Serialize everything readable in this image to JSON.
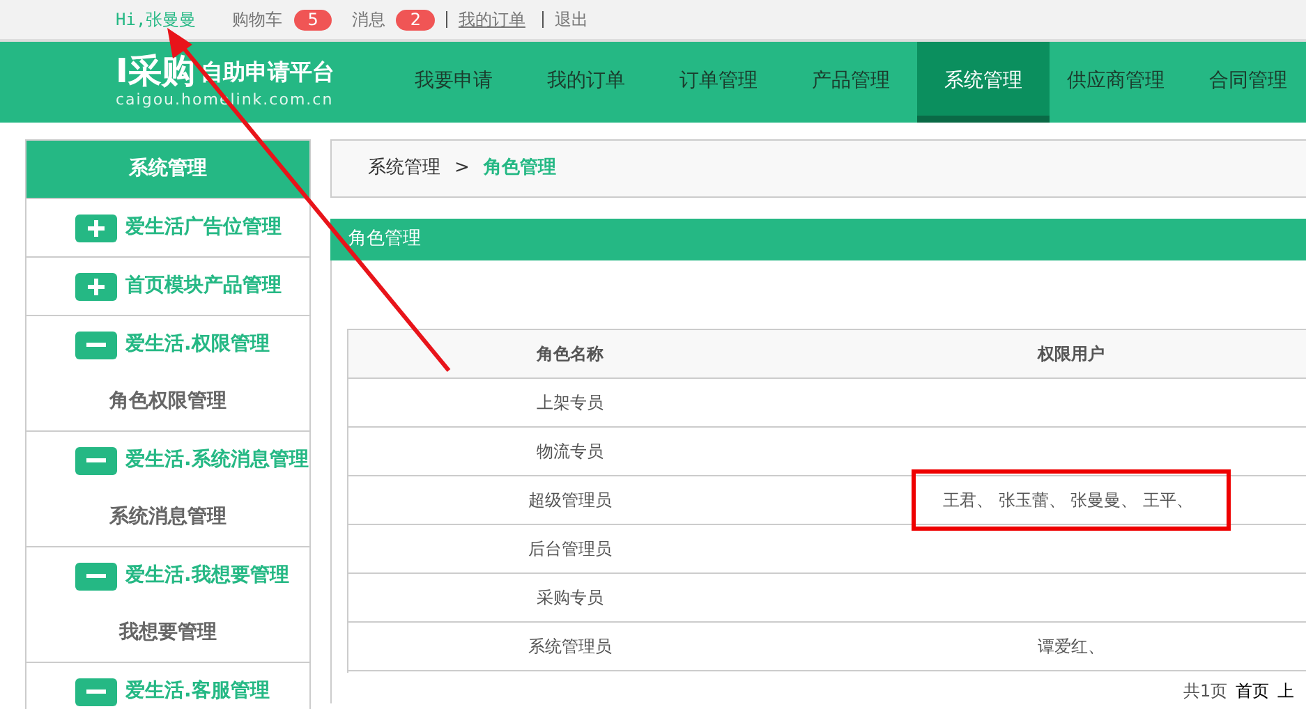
{
  "top_bar": {
    "greeting": "Hi,张曼曼",
    "links": [
      {
        "label": "购物车",
        "badge": "5"
      },
      {
        "label": "消息",
        "badge": "2"
      },
      {
        "label": "我的订单",
        "underlined": true
      },
      {
        "label": "退出",
        "underlined": false
      }
    ]
  },
  "logo": {
    "mark": "I采购",
    "title": "自助申请平台",
    "domain": "caigou.homelink.com.cn"
  },
  "nav": [
    {
      "label": "我要申请",
      "selected": false
    },
    {
      "label": "我的订单",
      "selected": false
    },
    {
      "label": "订单管理",
      "selected": false
    },
    {
      "label": "产品管理",
      "selected": false
    },
    {
      "label": "系统管理",
      "selected": true
    },
    {
      "label": "供应商管理",
      "selected": false
    },
    {
      "label": "合同管理",
      "selected": false
    }
  ],
  "sidebar": {
    "title": "系统管理",
    "groups": [
      {
        "label": "爱生活广告位管理",
        "expanded": false
      },
      {
        "label": "首页模块产品管理",
        "expanded": false
      },
      {
        "label": "爱生活.权限管理",
        "expanded": true,
        "children": [
          {
            "label": "角色权限管理"
          }
        ]
      },
      {
        "label": "爱生活.系统消息管理",
        "expanded": true,
        "children": [
          {
            "label": "系统消息管理"
          }
        ]
      },
      {
        "label": "爱生活.我想要管理",
        "expanded": true,
        "children": [
          {
            "label": "我想要管理"
          }
        ]
      },
      {
        "label": "爱生活.客服管理",
        "expanded": true
      }
    ]
  },
  "breadcrumb": [
    {
      "label": "系统管理",
      "current": false
    },
    {
      "label": "角色管理",
      "current": true
    }
  ],
  "breadcrumb_separator": ">",
  "panel": {
    "title": "角色管理",
    "table": {
      "columns": [
        "角色名称",
        "权限用户"
      ],
      "rows": [
        {
          "role": "上架专员"
        },
        {
          "role": "物流专员"
        },
        {
          "role": "超级管理员",
          "users": "王君、 张玉蕾、 张曼曼、 王平、",
          "highlighted": true
        },
        {
          "role": "后台管理员"
        },
        {
          "role": "采购专员"
        },
        {
          "role": "系统管理员",
          "users": "谭爱红、",
          "highlighted": false
        }
      ]
    },
    "pagination": [
      "共1页",
      "首页",
      "上"
    ]
  },
  "annotations": [
    {
      "kind": "arrow"
    }
  ]
}
